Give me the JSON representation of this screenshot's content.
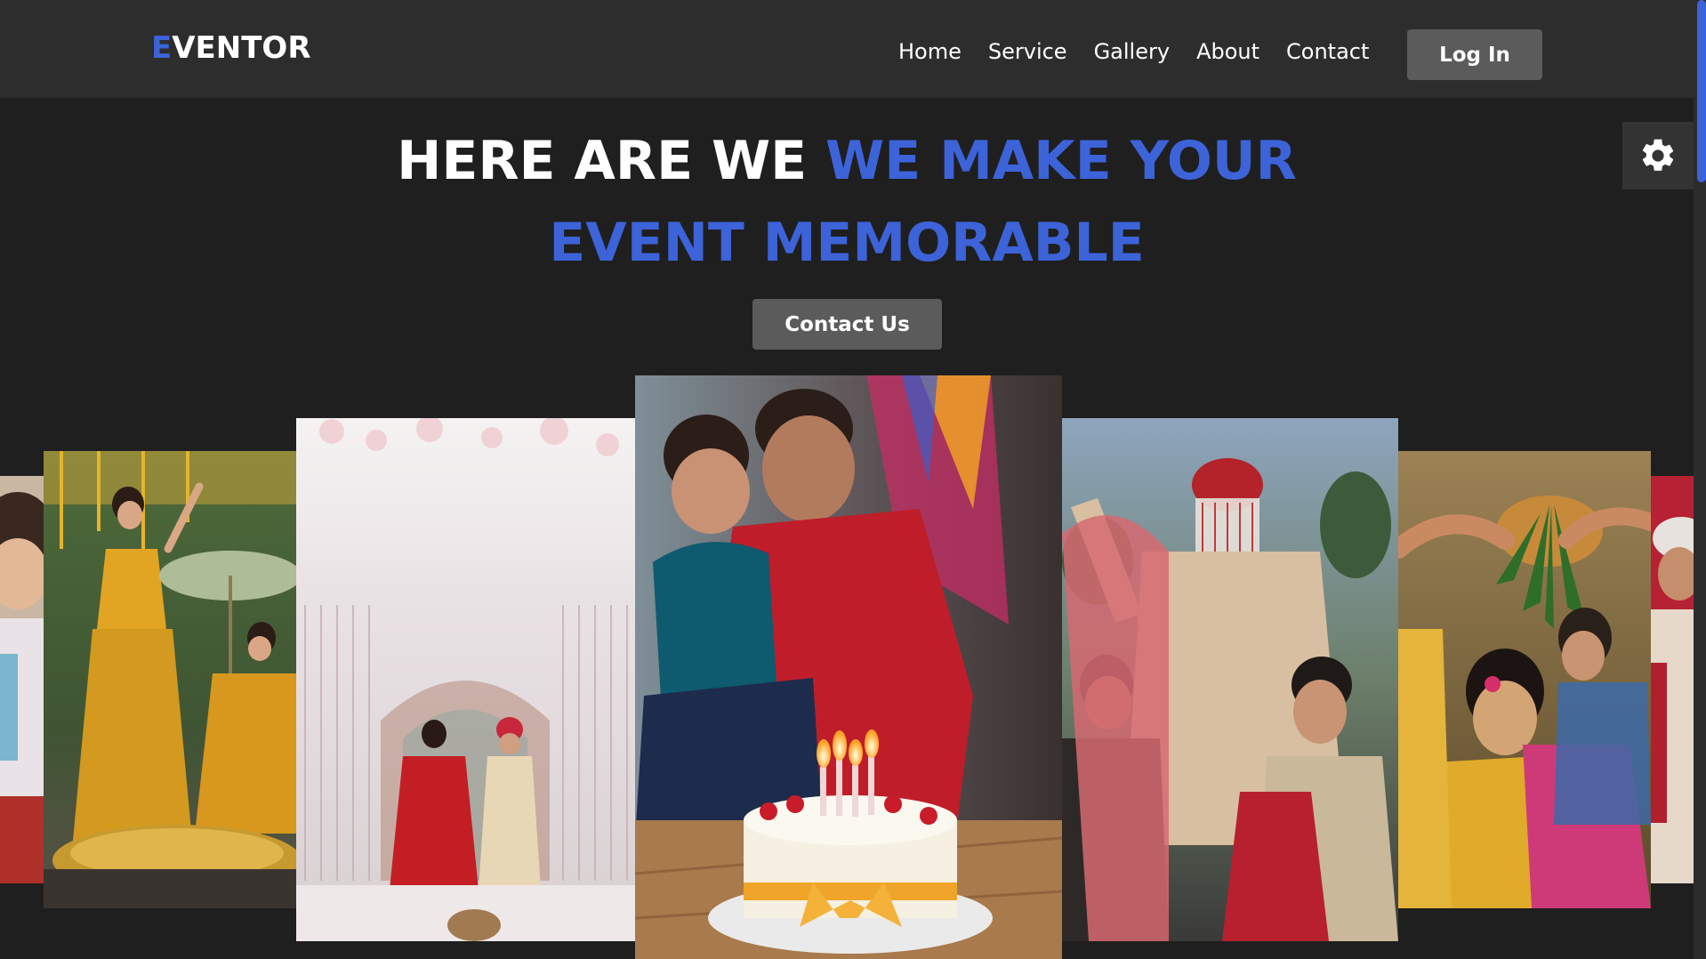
{
  "brand": {
    "logo_first": "E",
    "logo_rest": "VENTOR",
    "accent_color": "#3d63d9"
  },
  "nav": {
    "items": [
      {
        "label": "Home"
      },
      {
        "label": "Service"
      },
      {
        "label": "Gallery"
      },
      {
        "label": "About"
      },
      {
        "label": "Contact"
      }
    ],
    "login_label": "Log In"
  },
  "hero": {
    "line1_white": "HERE ARE WE",
    "line1_blue": "WE MAKE YOUR",
    "line2": "EVENT MEMORABLE",
    "cta_label": "Contact Us"
  },
  "settings": {
    "icon": "gear-icon"
  },
  "gallery": {
    "photos": [
      {
        "name": "photo-child-edge"
      },
      {
        "name": "photo-haldi-umbrella"
      },
      {
        "name": "photo-wedding-mandap"
      },
      {
        "name": "photo-birthday-cake"
      },
      {
        "name": "photo-groom-procession"
      },
      {
        "name": "photo-haldi-ceremony"
      },
      {
        "name": "photo-turban-edge"
      }
    ]
  }
}
